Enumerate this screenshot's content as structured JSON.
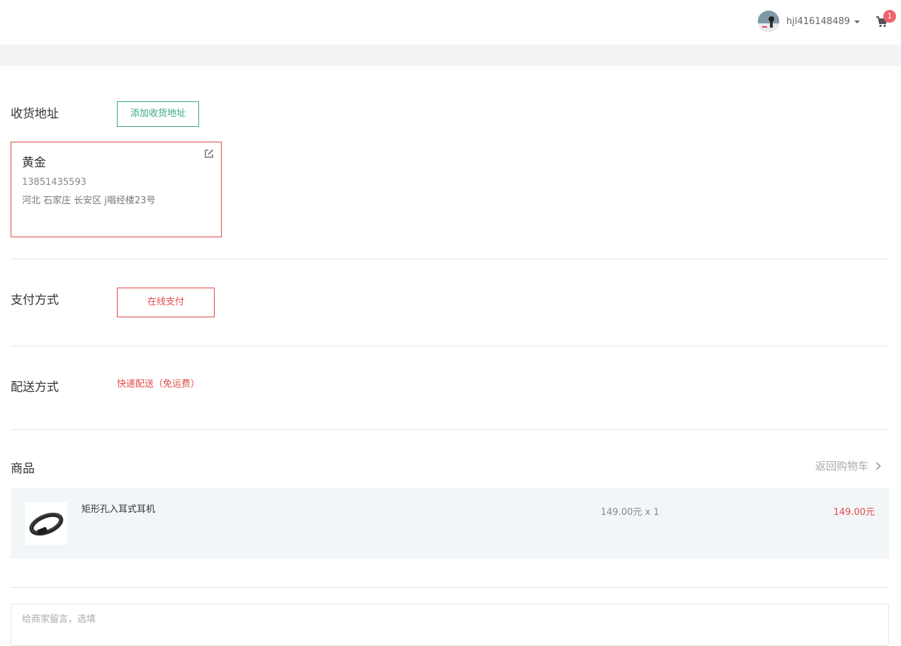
{
  "header": {
    "username": "hjl416148489",
    "cart_count": "1"
  },
  "address": {
    "section_title": "收货地址",
    "add_button": "添加收货地址",
    "name": "黄金",
    "phone": "13851435593",
    "detail": "河北 石家庄 长安区 j唱经楼23号"
  },
  "payment": {
    "section_title": "支付方式",
    "method": "在线支付"
  },
  "delivery": {
    "section_title": "配送方式",
    "method": "快递配送（免运费）"
  },
  "products": {
    "section_title": "商品",
    "back_to_cart": "返回购物车",
    "items": [
      {
        "name": "矩形孔入耳式耳机",
        "price_qty": "149.00元 x 1",
        "subtotal": "149.00元"
      }
    ]
  },
  "message": {
    "placeholder": "给商家留言，选填"
  },
  "colors": {
    "accent_red": "#e24b4b",
    "accent_green": "#37a97f",
    "badge": "#f2616a"
  }
}
